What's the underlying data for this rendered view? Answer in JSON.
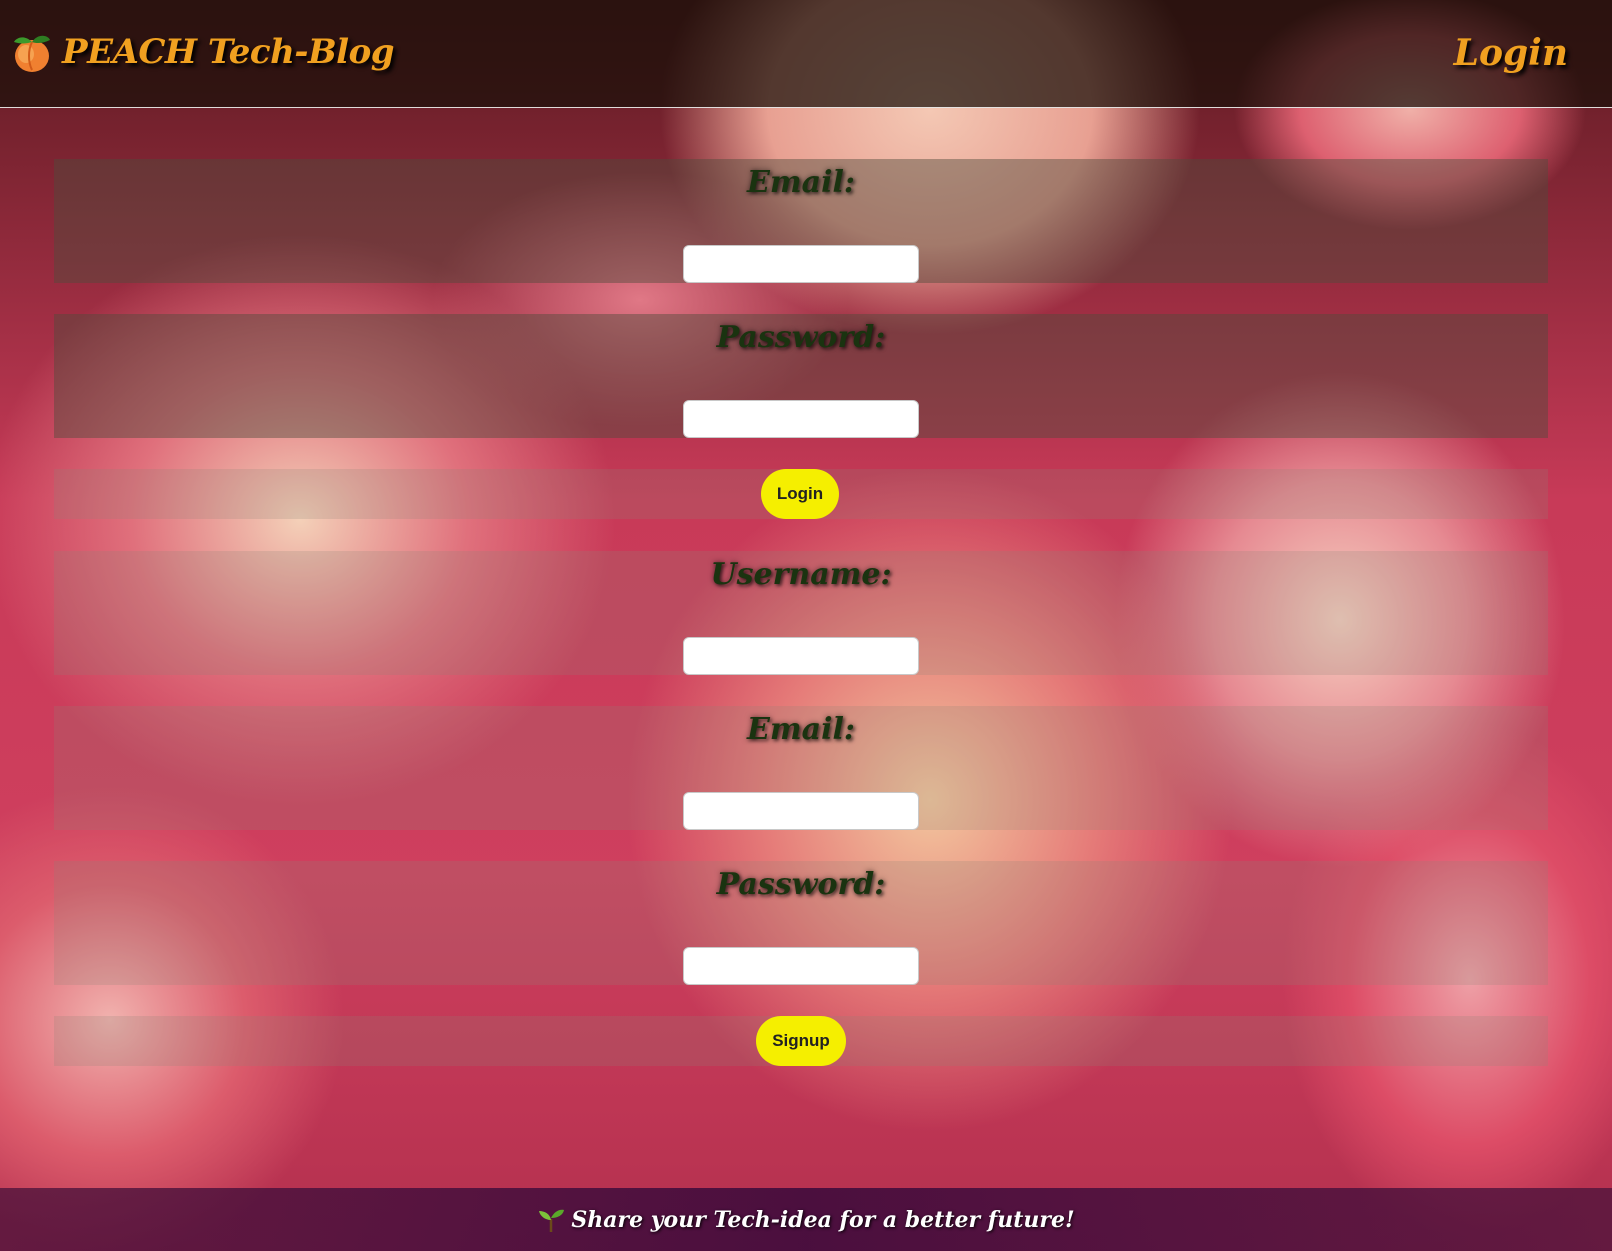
{
  "header": {
    "brand_icon": "peach-icon",
    "brand_title": "PEACH Tech-Blog",
    "nav_login": "Login",
    "brand_color": "#f0a020"
  },
  "login_form": {
    "email_label": "Email:",
    "email_value": "",
    "password_label": "Password:",
    "password_value": "",
    "submit_label": "Login"
  },
  "signup_form": {
    "username_label": "Username:",
    "username_value": "",
    "email_label": "Email:",
    "email_value": "",
    "password_label": "Password:",
    "password_value": "",
    "submit_label": "Signup"
  },
  "footer": {
    "icon": "sprout-icon",
    "text": "Share your Tech-idea for a better future!"
  },
  "colors": {
    "button": "#f5ef00",
    "label_text": "#1a3310",
    "footer_bg": "#3c0a3c"
  }
}
